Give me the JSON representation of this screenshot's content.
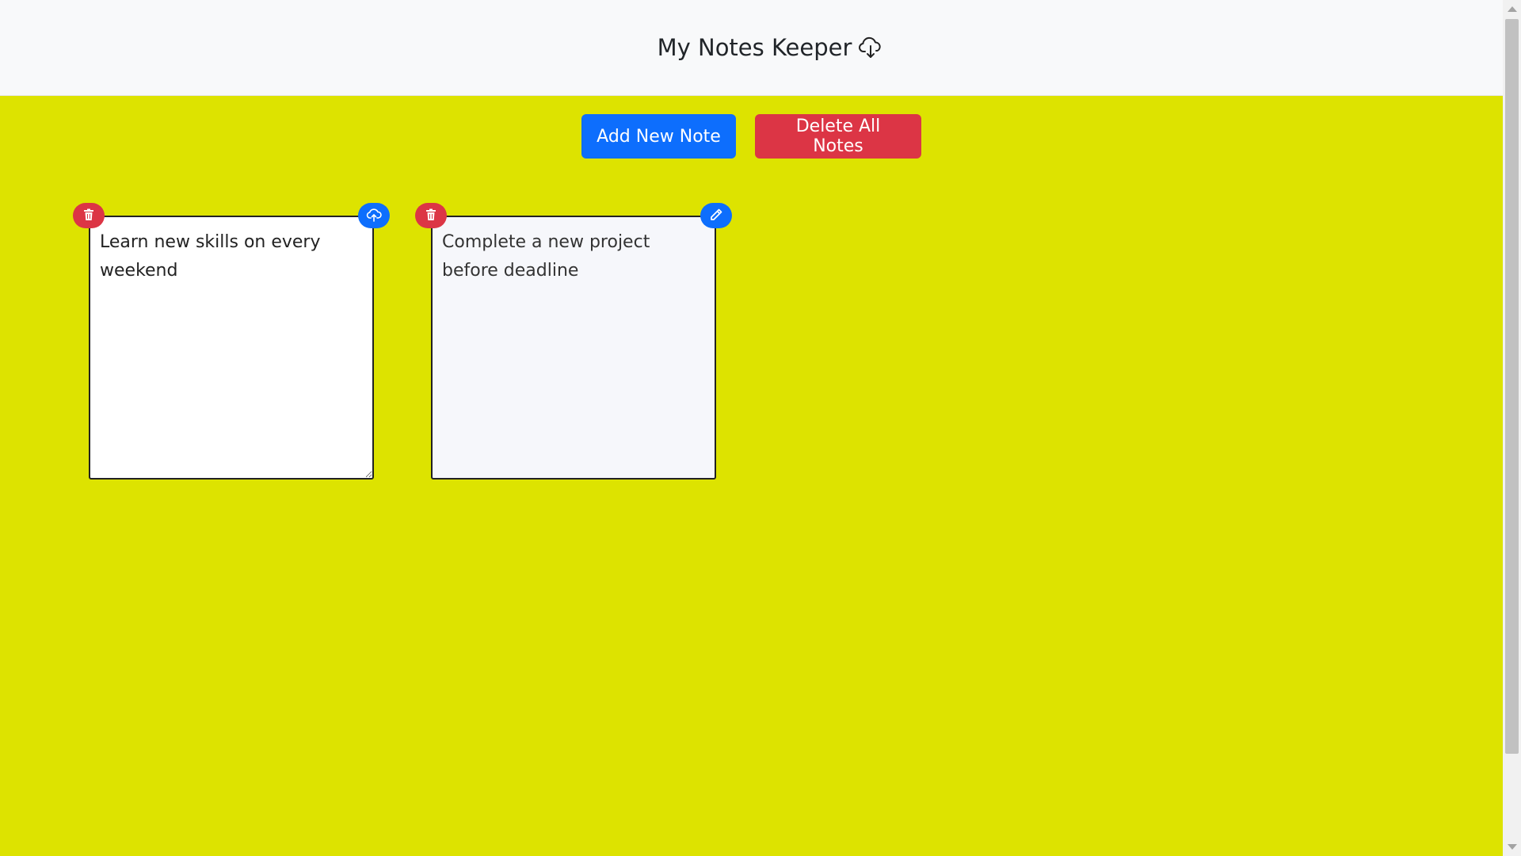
{
  "header": {
    "title": "My Notes Keeper",
    "icon": "cloud-download-icon"
  },
  "toolbar": {
    "add_label": "Add New Note",
    "delete_all_label": "Delete All Notes"
  },
  "notes": [
    {
      "text": "Learn new skills on every weekend",
      "mode": "editing",
      "left_icon": "trash-icon",
      "right_icon": "cloud-upload-icon"
    },
    {
      "text": "Complete a new project before deadline",
      "mode": "view",
      "left_icon": "trash-icon",
      "right_icon": "pencil-icon"
    }
  ],
  "colors": {
    "background": "#dde300",
    "header_bg": "#f8f9fa",
    "primary": "#0d6efd",
    "danger": "#dc3545"
  }
}
